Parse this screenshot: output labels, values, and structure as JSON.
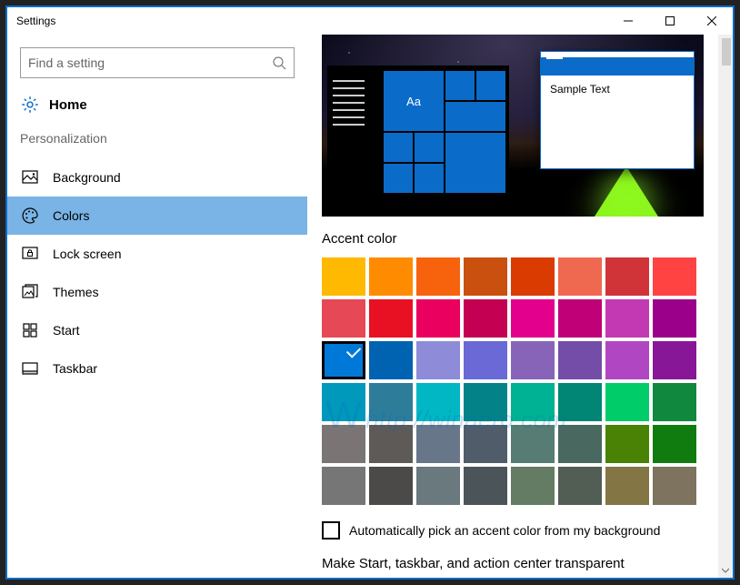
{
  "window": {
    "title": "Settings"
  },
  "search": {
    "placeholder": "Find a setting"
  },
  "home_label": "Home",
  "category_label": "Personalization",
  "nav": [
    {
      "label": "Background",
      "key": "background",
      "selected": false
    },
    {
      "label": "Colors",
      "key": "colors",
      "selected": true
    },
    {
      "label": "Lock screen",
      "key": "lockscreen",
      "selected": false
    },
    {
      "label": "Themes",
      "key": "themes",
      "selected": false
    },
    {
      "label": "Start",
      "key": "start",
      "selected": false
    },
    {
      "label": "Taskbar",
      "key": "taskbar",
      "selected": false
    }
  ],
  "preview": {
    "tile_text": "Aa",
    "sample_window_text": "Sample Text",
    "accent": "#0a6bc9"
  },
  "section_title": "Accent color",
  "selected_swatch_index": 16,
  "swatches": [
    "#ffb900",
    "#ff8c00",
    "#f7630c",
    "#ca5010",
    "#da3b01",
    "#ef6950",
    "#d13438",
    "#ff4343",
    "#e74856",
    "#e81123",
    "#ea005e",
    "#c30052",
    "#e3008c",
    "#bf0077",
    "#c239b3",
    "#9a0089",
    "#0078d7",
    "#0063b1",
    "#8e8cd8",
    "#6b69d6",
    "#8764b8",
    "#744da9",
    "#b146c2",
    "#881798",
    "#0099bc",
    "#2d7d9a",
    "#00b7c3",
    "#038387",
    "#00b294",
    "#018574",
    "#00cc6a",
    "#10893e",
    "#7a7574",
    "#5d5a58",
    "#68768a",
    "#515c6b",
    "#567c73",
    "#486860",
    "#498205",
    "#107c10",
    "#767676",
    "#4c4a48",
    "#69797e",
    "#4a5459",
    "#647c64",
    "#525e54",
    "#847545",
    "#7e735f"
  ],
  "checkbox_label": "Automatically pick an accent color from my background",
  "checkbox_checked": false,
  "cutoff_text": "Make Start, taskbar, and action center transparent",
  "watermark": "http://winaero.com"
}
